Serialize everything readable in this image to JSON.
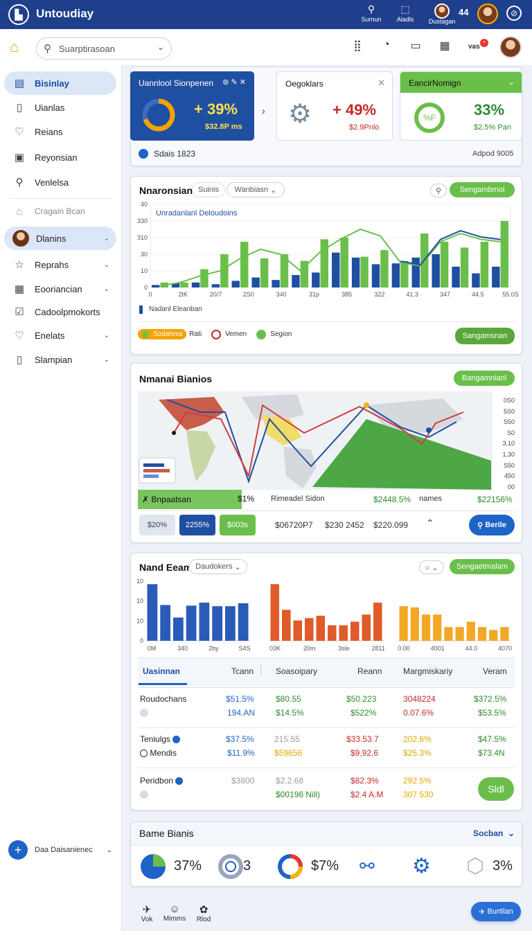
{
  "app": {
    "logo": "▙",
    "title": "Untoudiay"
  },
  "topnav": [
    {
      "icon": "⚲",
      "label": "Surnun"
    },
    {
      "icon": "⬚",
      "label": "Aladls"
    },
    {
      "icon": "",
      "label": "Dustagan"
    }
  ],
  "topbar_count": "44",
  "search": {
    "placeholder": "Suarptirasoan"
  },
  "notif_label": "vas",
  "sidebar": {
    "items": [
      {
        "icon": "▤",
        "label": "Bisinlay"
      },
      {
        "icon": "▯",
        "label": "Uianlas"
      },
      {
        "icon": "♡",
        "label": "Reians"
      },
      {
        "icon": "▣",
        "label": "Reyonsian"
      },
      {
        "icon": "⚲",
        "label": "Venlelsa"
      }
    ],
    "section": {
      "icon": "⌂",
      "label": "Cragain Bcan"
    },
    "items2": [
      {
        "label": "Dlanins",
        "chev": "⌄"
      },
      {
        "icon": "☆",
        "label": "Reprahs",
        "chev": "⌄"
      },
      {
        "icon": "▦",
        "label": "Eooriancian",
        "chev": "⌄"
      },
      {
        "icon": "☑",
        "label": "Cadoolpmokorts"
      },
      {
        "icon": "♡",
        "label": "Enelats",
        "chev": "⌄"
      },
      {
        "icon": "▯",
        "label": "Slampian",
        "chev": "⌄"
      }
    ],
    "footer": {
      "label": "Daa Daisanienec"
    }
  },
  "kpi": {
    "k1": {
      "title": "Uannlool Sionpenen",
      "value": "+ 39%",
      "sub": "$32.8P ms",
      "donut": 0.7
    },
    "k2": {
      "title": "Oegoklars",
      "value": "+ 49%",
      "sub": "$2.9Pnlo"
    },
    "k3": {
      "title": "EancirNomign",
      "value": "33%",
      "sub": "$2.5% Pan",
      "ring_label": "%F"
    },
    "footer_left": "Sdais 1823",
    "footer_right": "Adpod 9005"
  },
  "chart1": {
    "title": "Nnaronsian",
    "tab1": "Suinis",
    "tab2": "Wanbiasn",
    "button": "Sengambmol",
    "label": "Unradanlanl Deloudoins",
    "legend_note": "Nadanl Eleanban",
    "x_ticks": [
      "0",
      "2tK",
      "20/7",
      "2S0",
      "340",
      "31p",
      "385",
      "322",
      "41.3",
      "347",
      "44.5",
      "55.0S"
    ],
    "y_ticks": [
      "0",
      "10",
      "30",
      "310",
      "330",
      "40"
    ],
    "pills": [
      {
        "label": "Sodahnia",
        "color": "#f4a300"
      },
      {
        "label": "Rati",
        "color": "#6abf4b"
      },
      {
        "label": "Vemen",
        "color": "#c62828"
      },
      {
        "label": "Segion",
        "color": "#6abf4b"
      }
    ],
    "button2": "Sangamsnan"
  },
  "chart_data": [
    {
      "type": "bar",
      "series": [
        {
          "name": "",
          "color": "#1f4fa0",
          "values": [
            3,
            5,
            6,
            4,
            8,
            12,
            9,
            15,
            18,
            42,
            36,
            28,
            29,
            36,
            40,
            25,
            17,
            25
          ]
        },
        {
          "name": "",
          "color": "#6abf4b",
          "values": [
            6,
            6,
            22,
            40,
            55,
            35,
            40,
            32,
            58,
            60,
            37,
            45,
            32,
            65,
            55,
            48,
            55,
            80
          ]
        }
      ],
      "line": [
        2,
        6,
        14,
        20,
        35,
        46,
        40,
        20,
        43,
        58,
        70,
        62,
        30,
        26,
        55,
        65,
        58,
        55
      ]
    },
    {
      "type": "bar",
      "series": [
        {
          "name": "",
          "color": "#2a5bb8",
          "values": [
            9.5,
            6,
            3.9,
            5.9,
            6.4,
            5.8,
            5.8,
            6.3
          ]
        }
      ]
    },
    {
      "type": "bar",
      "series": [
        {
          "name": "",
          "color": "#e05a2a",
          "values": [
            9.5,
            5.2,
            3.4,
            3.8,
            4.2,
            2.6,
            2.6,
            3.2,
            4.4,
            6.4
          ]
        }
      ]
    },
    {
      "type": "bar",
      "series": [
        {
          "name": "",
          "color": "#f2a726",
          "values": [
            5.8,
            5.6,
            4.4,
            4.4,
            2.3,
            2.3,
            3.2,
            2.3,
            1.8,
            2.3
          ]
        }
      ]
    }
  ],
  "map": {
    "title": "Nmanai Bianios",
    "button": "Bangamnianl",
    "y_ticks": [
      "0S0",
      "5S0",
      "S50",
      "S0",
      "3,10",
      "1,30",
      "S50",
      "450",
      "00"
    ],
    "strip": {
      "label": "Bnpaatsan",
      "value": "$1%",
      "center": "Rimeadel Sidon",
      "v1": "$2448.5%",
      "k2": "names",
      "v2": "$22156%"
    },
    "chips": [
      "$20%",
      "2255%",
      "$003s"
    ],
    "vals": [
      "$06720P7",
      "$230 2452",
      "$220.099"
    ],
    "button2": "Berile"
  },
  "panel3": {
    "title": "Nand Eeam",
    "tab": "Daudokers",
    "button": "Sengaetmalam",
    "x1": [
      "0M",
      "340",
      "2by",
      "S4S"
    ],
    "y1": [
      "10",
      "10",
      "10",
      "0"
    ],
    "x2": [
      "03K",
      "20m",
      "3sle",
      "2811"
    ],
    "x3": [
      "0.00",
      "4001",
      "44.0",
      "4070"
    ]
  },
  "table": {
    "headers": [
      "Uasinnan",
      "Tcann",
      "Soasoipary",
      "Reann",
      "Margmiskariy",
      "Veram"
    ],
    "rows": [
      {
        "c0": "Roudochans",
        "c1a": "$51.5%",
        "c1b": "194.AN",
        "c2a": "$80.55",
        "c2b": "$14.5%",
        "c3a": "$50.223",
        "c3b": "$522%",
        "c4a": "3048224",
        "c4b": "0.07.6%",
        "c5a": "$372.5%",
        "c5b": "$53.5%"
      },
      {
        "c0": "Teniulgs",
        "c0b": "Mendis",
        "c1a": "$37.5%",
        "c1b": "$11.9%",
        "c2a": "215.55",
        "c2b": "$59656",
        "c3a": "$33.53.7",
        "c3b": "$9,92.6",
        "c4a": "202.6%",
        "c4b": "$25.3%",
        "c5a": "$47.5%",
        "c5b": "$73.4N"
      },
      {
        "c0": "Peridbon",
        "c1a": "$3800",
        "c2a": "$2.2.68",
        "c2b": "$00196  Nill)",
        "c3a": "$82.3%",
        "c3b": "$2.4 A.M",
        "c4a": "292 5%",
        "c4b": "307 530",
        "btn": "Sldl"
      }
    ]
  },
  "bottom": {
    "title": "Bame Bianis",
    "right": "Socban",
    "items": [
      "37%",
      "3",
      "$7%",
      "",
      "",
      "3%"
    ]
  },
  "bottomnav": [
    {
      "icon": "✈",
      "label": "Vok"
    },
    {
      "icon": "☺",
      "label": "Mimms"
    },
    {
      "icon": "✿",
      "label": "Rlod"
    }
  ],
  "fab": "Burtilan"
}
